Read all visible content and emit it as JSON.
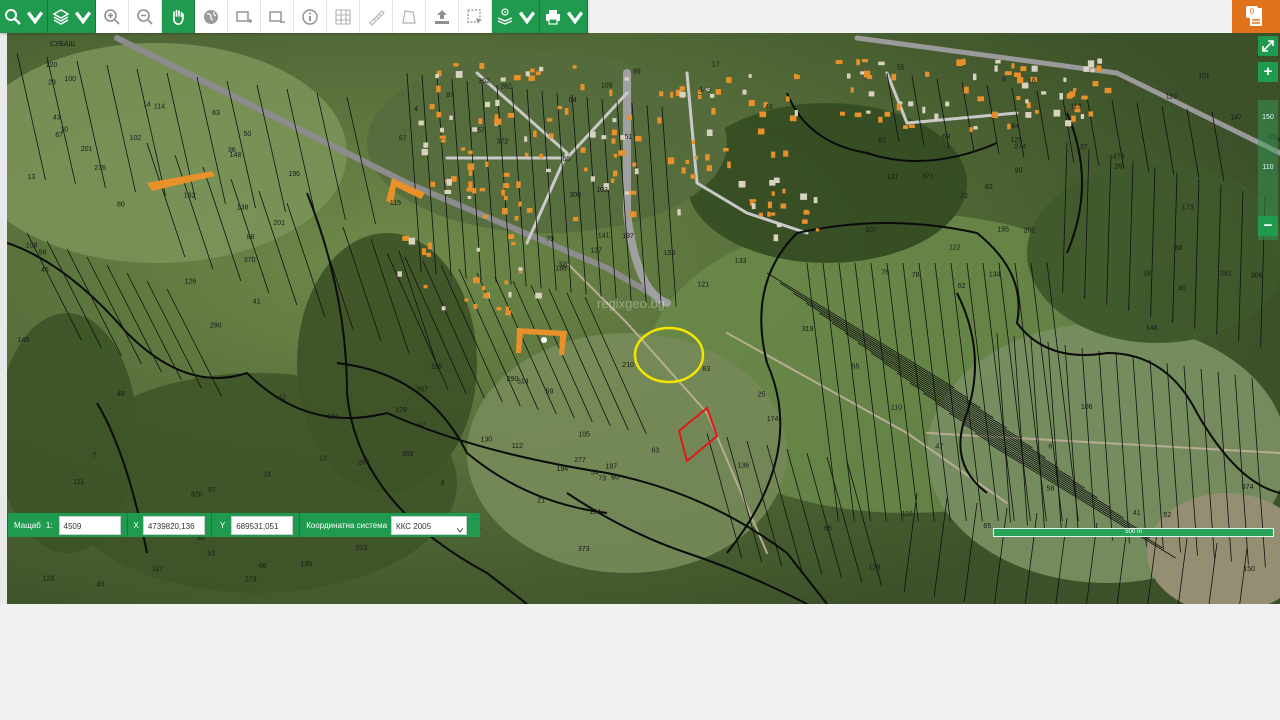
{
  "toolbar": {
    "buttons": [
      {
        "icon": "search-icon",
        "dropdown": true
      },
      {
        "icon": "layers-icon",
        "dropdown": true
      },
      {
        "icon": "zoom-in-icon"
      },
      {
        "icon": "zoom-out-icon"
      },
      {
        "icon": "pan-hand-icon",
        "active": true
      },
      {
        "icon": "globe-icon"
      },
      {
        "icon": "add-rectangle-icon"
      },
      {
        "icon": "remove-rectangle-icon"
      },
      {
        "icon": "info-icon"
      },
      {
        "icon": "grid-icon"
      },
      {
        "icon": "ruler-icon"
      },
      {
        "icon": "polygon-area-icon"
      },
      {
        "icon": "upload-icon"
      },
      {
        "icon": "select-area-icon"
      },
      {
        "icon": "layers-info-icon",
        "dropdown": true
      },
      {
        "icon": "print-icon",
        "dropdown": true
      }
    ]
  },
  "user": {
    "badge": "0",
    "icon": "document-user-icon"
  },
  "zoom_control": {
    "expand_icon": "expand-icon",
    "plus": "+",
    "minus": "−",
    "ticks": [
      "150",
      "",
      "",
      "",
      "110"
    ]
  },
  "coords": {
    "scale_label": "Мащаб",
    "scale_prefix": "1:",
    "scale_value": "4509",
    "x_label": "X",
    "x_value": "4739820,136",
    "y_label": "Y",
    "y_value": "689531,051",
    "system_label": "Координатна система",
    "system_value": "ККС 2005"
  },
  "scalebar": {
    "label": "500 m"
  },
  "map": {
    "place_name": "СУБАШ",
    "colors": {
      "highlight_yellow": "#f2e600",
      "highlight_red": "#e01818",
      "building": "#e8912a",
      "road": "#c9c9c9"
    },
    "parcel_labels": [
      "36",
      "57",
      "76",
      "97",
      "73",
      "72",
      "67",
      "66",
      "65",
      "38",
      "59",
      "60",
      "102",
      "99",
      "62",
      "42",
      "187",
      "101",
      "100",
      "188",
      "41",
      "40",
      "63",
      "64",
      "43",
      "103",
      "55",
      "48",
      "194",
      "195",
      "196",
      "197",
      "47",
      "290",
      "277",
      "274",
      "276",
      "282",
      "281",
      "273",
      "373",
      "371",
      "370",
      "372",
      "6",
      "7",
      "8",
      "9",
      "10",
      "362",
      "374",
      "369",
      "367",
      "476",
      "13",
      "17",
      "18",
      "24",
      "25",
      "28",
      "29",
      "155",
      "106",
      "104",
      "105",
      "107",
      "108",
      "109",
      "110",
      "111",
      "112",
      "113",
      "114",
      "115",
      "116",
      "117",
      "118",
      "119",
      "120",
      "121",
      "122",
      "123",
      "124",
      "125",
      "126",
      "127",
      "128",
      "129",
      "130",
      "131",
      "132",
      "133",
      "134",
      "135",
      "136",
      "137",
      "138",
      "141",
      "146",
      "145",
      "91",
      "90",
      "88",
      "87",
      "86",
      "85",
      "83",
      "82",
      "80",
      "79",
      "78",
      "10",
      "21",
      "45",
      "46",
      "42",
      "40",
      "41",
      "60",
      "62",
      "63",
      "64",
      "65",
      "66",
      "67",
      "68",
      "50",
      "51",
      "52",
      "53",
      "54",
      "55",
      "56",
      "57",
      "58",
      "206",
      "210",
      "202",
      "201",
      "326",
      "319",
      "320",
      "174",
      "173",
      "201",
      "300",
      "306",
      "513",
      "514",
      "147",
      "148",
      "149",
      "150",
      "322",
      "290",
      "16",
      "14",
      "4"
    ]
  }
}
